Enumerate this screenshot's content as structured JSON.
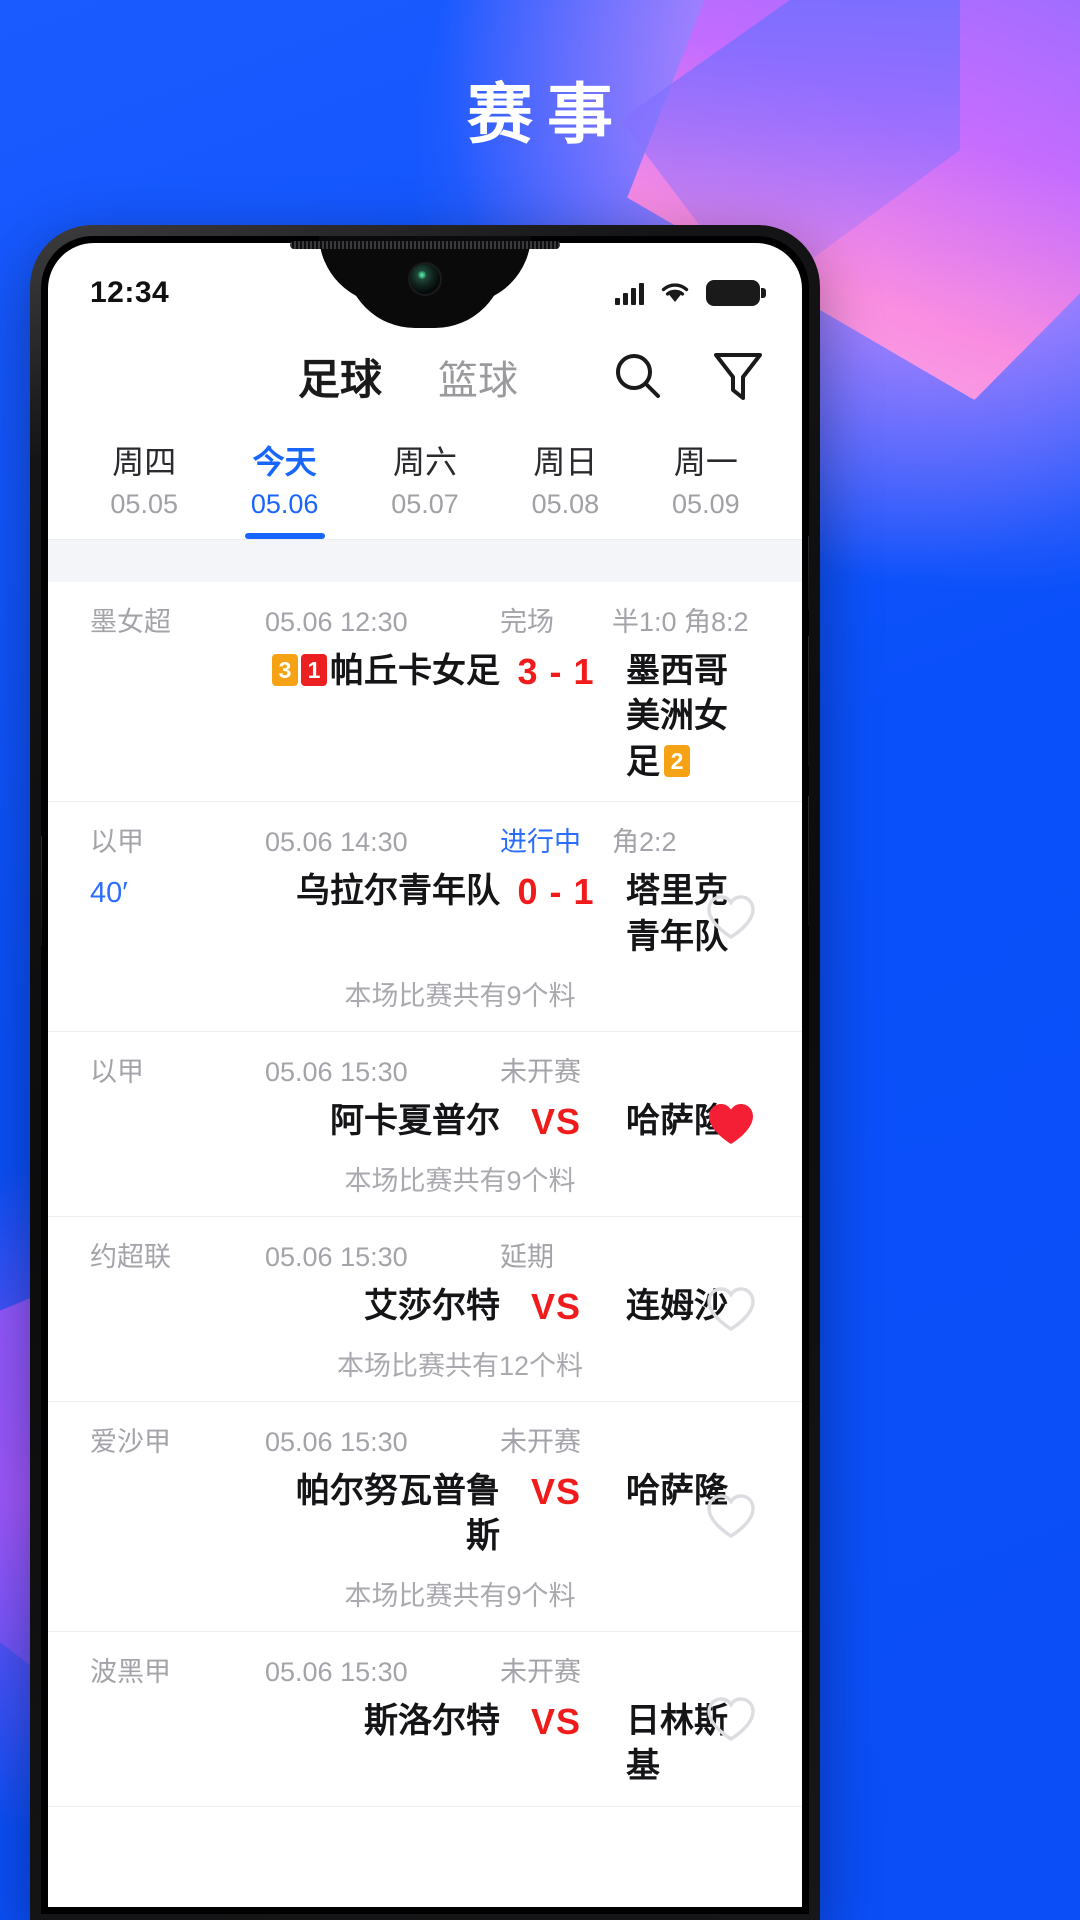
{
  "hero": {
    "title": "赛事"
  },
  "status_bar": {
    "time": "12:34",
    "icons": [
      "signal-icon",
      "wifi-icon",
      "battery-icon"
    ]
  },
  "header": {
    "sport_tabs": [
      {
        "label": "足球",
        "active": true
      },
      {
        "label": "篮球",
        "active": false
      }
    ],
    "actions": [
      {
        "name": "search-icon"
      },
      {
        "name": "filter-icon"
      }
    ]
  },
  "date_tabs": [
    {
      "dow": "周四",
      "date": "05.05",
      "active": false
    },
    {
      "dow": "今天",
      "date": "05.06",
      "active": true
    },
    {
      "dow": "周六",
      "date": "05.07",
      "active": false
    },
    {
      "dow": "周日",
      "date": "05.08",
      "active": false
    },
    {
      "dow": "周一",
      "date": "05.09",
      "active": false
    }
  ],
  "colors": {
    "brand_blue": "#0a55fa",
    "accent_blue": "#1966ff",
    "score_red": "#f01c1c",
    "yellow_card": "#f5a315",
    "red_card": "#ec2020",
    "fav_red": "#f41f34",
    "muted_text": "#a3a3a9"
  },
  "matches": [
    {
      "league": "墨女超",
      "datetime": "05.06 12:30",
      "status": "完场",
      "status_live": false,
      "extra": "半1:0 角8:2",
      "minute": "",
      "home": "帕丘卡女足",
      "home_cards": [
        {
          "type": "yellow",
          "value": "3"
        },
        {
          "type": "red",
          "value": "1"
        }
      ],
      "score": "3 - 1",
      "away": "墨西哥美洲女足",
      "away_cards": [
        {
          "type": "yellow",
          "value": "2"
        }
      ],
      "note": "",
      "favorite": false,
      "show_fav": false
    },
    {
      "league": "以甲",
      "datetime": "05.06 14:30",
      "status": "进行中",
      "status_live": true,
      "extra": "角2:2",
      "minute": "40′",
      "home": "乌拉尔青年队",
      "home_cards": [],
      "score": "0 - 1",
      "away": "塔里克青年队",
      "away_cards": [],
      "note": "本场比赛共有9个料",
      "favorite": false,
      "show_fav": true
    },
    {
      "league": "以甲",
      "datetime": "05.06 15:30",
      "status": "未开赛",
      "status_live": false,
      "extra": "",
      "minute": "",
      "home": "阿卡夏普尔",
      "home_cards": [],
      "score": "VS",
      "away": "哈萨隆",
      "away_cards": [],
      "note": "本场比赛共有9个料",
      "favorite": true,
      "show_fav": true
    },
    {
      "league": "约超联",
      "datetime": "05.06 15:30",
      "status": "延期",
      "status_live": false,
      "extra": "",
      "minute": "",
      "home": "艾莎尔特",
      "home_cards": [],
      "score": "VS",
      "away": "连姆沙",
      "away_cards": [],
      "note": "本场比赛共有12个料",
      "favorite": false,
      "show_fav": true
    },
    {
      "league": "爱沙甲",
      "datetime": "05.06 15:30",
      "status": "未开赛",
      "status_live": false,
      "extra": "",
      "minute": "",
      "home": "帕尔努瓦普鲁斯",
      "home_cards": [],
      "score": "VS",
      "away": "哈萨隆",
      "away_cards": [],
      "note": "本场比赛共有9个料",
      "favorite": false,
      "show_fav": true
    },
    {
      "league": "波黑甲",
      "datetime": "05.06 15:30",
      "status": "未开赛",
      "status_live": false,
      "extra": "",
      "minute": "",
      "home": "斯洛尔特",
      "home_cards": [],
      "score": "VS",
      "away": "日林斯基",
      "away_cards": [],
      "note": "",
      "favorite": false,
      "show_fav": true
    }
  ]
}
